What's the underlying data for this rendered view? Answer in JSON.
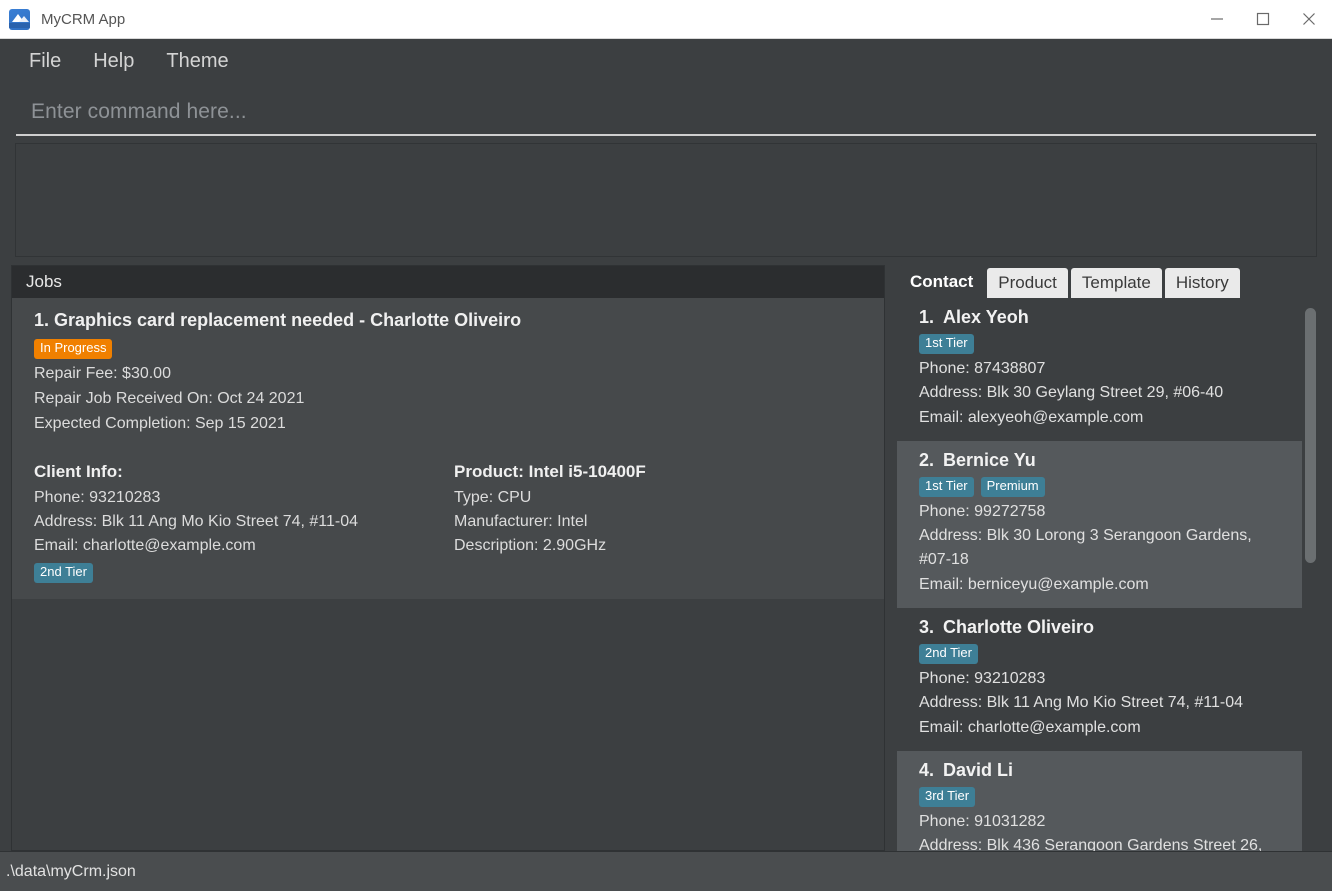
{
  "window": {
    "title": "MyCRM App",
    "app_icon": "app-logo-icon",
    "controls": {
      "minimize": "minimize-icon",
      "maximize": "maximize-icon",
      "close": "close-icon"
    }
  },
  "menubar": {
    "items": [
      {
        "label": "File"
      },
      {
        "label": "Help"
      },
      {
        "label": "Theme"
      }
    ]
  },
  "command": {
    "placeholder": "Enter command here...",
    "value": ""
  },
  "result_box": {
    "text": ""
  },
  "jobs_panel": {
    "header": "Jobs",
    "jobs": [
      {
        "title": "1. Graphics card replacement needed - Charlotte Oliveiro",
        "status": "In Progress",
        "status_color": "#f08000",
        "fee": "Repair Fee: $30.00",
        "received": "Repair Job Received On: Oct 24 2021",
        "completion": "Expected Completion: Sep 15 2021",
        "client": {
          "heading": "Client Info:",
          "phone": "Phone: 93210283",
          "address": "Address: Blk 11 Ang Mo Kio Street 74, #11-04",
          "email": "Email: charlotte@example.com",
          "tier": "2nd Tier"
        },
        "product": {
          "heading": "Product: Intel i5-10400F",
          "type": "Type: CPU",
          "manufacturer": "Manufacturer: Intel",
          "description": "Description: 2.90GHz"
        }
      }
    ]
  },
  "right_panel": {
    "tabs": [
      {
        "label": "Contact",
        "active": true
      },
      {
        "label": "Product",
        "active": false
      },
      {
        "label": "Template",
        "active": false
      },
      {
        "label": "History",
        "active": false
      }
    ],
    "contacts": [
      {
        "index": "1.",
        "name": "Alex Yeoh",
        "tags": [
          "1st Tier"
        ],
        "phone": "Phone: 87438807",
        "address": "Address: Blk 30 Geylang Street 29, #06-40",
        "email": "Email: alexyeoh@example.com"
      },
      {
        "index": "2.",
        "name": "Bernice Yu",
        "tags": [
          "1st Tier",
          "Premium"
        ],
        "phone": "Phone: 99272758",
        "address": "Address: Blk 30 Lorong 3 Serangoon Gardens, #07-18",
        "email": "Email: berniceyu@example.com"
      },
      {
        "index": "3.",
        "name": "Charlotte Oliveiro",
        "tags": [
          "2nd Tier"
        ],
        "phone": "Phone: 93210283",
        "address": "Address: Blk 11 Ang Mo Kio Street 74, #11-04",
        "email": "Email: charlotte@example.com"
      },
      {
        "index": "4.",
        "name": "David Li",
        "tags": [
          "3rd Tier"
        ],
        "phone": "Phone: 91031282",
        "address": "Address: Blk 436 Serangoon Gardens Street 26,",
        "email": ""
      }
    ],
    "badge_color": "#3e7f96"
  },
  "statusbar": {
    "path": ".\\data\\myCrm.json"
  }
}
